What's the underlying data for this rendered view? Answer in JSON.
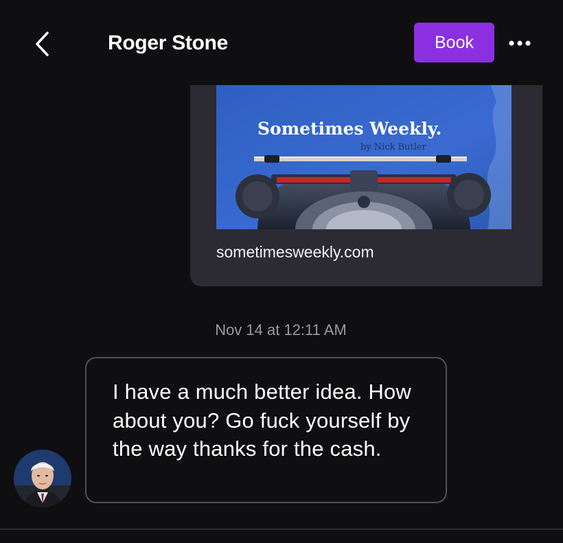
{
  "header": {
    "contact_name": "Roger Stone",
    "back_icon": "chevron-left-icon",
    "book_label": "Book",
    "more_icon": "more-horizontal-icon",
    "book_color": "#8b30e0"
  },
  "messages": [
    {
      "type": "link-preview",
      "preview_title": "Sometimes Weekly.",
      "preview_byline": "by Nick Butler",
      "url": "sometimesweekly.com"
    },
    {
      "type": "timestamp",
      "text": "Nov 14 at 12:11 AM"
    },
    {
      "type": "text",
      "text": "I have a much better idea. How about you? Go fuck yourself by the way thanks for the cash."
    }
  ],
  "colors": {
    "background": "#0f0f11",
    "card": "#2c2b33",
    "bubble_border": "#505057",
    "timestamp": "#9a9aa2"
  }
}
